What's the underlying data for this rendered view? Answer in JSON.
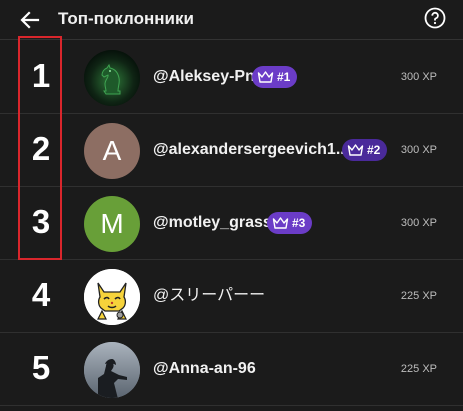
{
  "header": {
    "title": "Топ-поклонники",
    "back_icon": "arrow-left-icon",
    "help_icon": "question-circle-icon"
  },
  "colors": {
    "background": "#1b1b1b",
    "badge": "#6b3cc7",
    "highlight": "#d9262c"
  },
  "fans": [
    {
      "rank": "1",
      "name": "@Aleksey-Pn",
      "badge": "#1",
      "xp": "300 XP",
      "avatar": "chess-knight-image"
    },
    {
      "rank": "2",
      "name": "@alexandersergeevich1...",
      "badge": "#2",
      "xp": "300 XP",
      "avatar_letter": "A",
      "avatar_color": "#8d6e63"
    },
    {
      "rank": "3",
      "name": "@motley_grass",
      "badge": "#3",
      "xp": "300 XP",
      "avatar_letter": "M",
      "avatar_color": "#689f38"
    },
    {
      "rank": "4",
      "name": "@スリーパーー",
      "xp": "225 XP",
      "avatar": "cartoon-cat-image"
    },
    {
      "rank": "5",
      "name": "@Anna-an-96",
      "xp": "225 XP",
      "avatar": "silhouette-photo"
    }
  ]
}
